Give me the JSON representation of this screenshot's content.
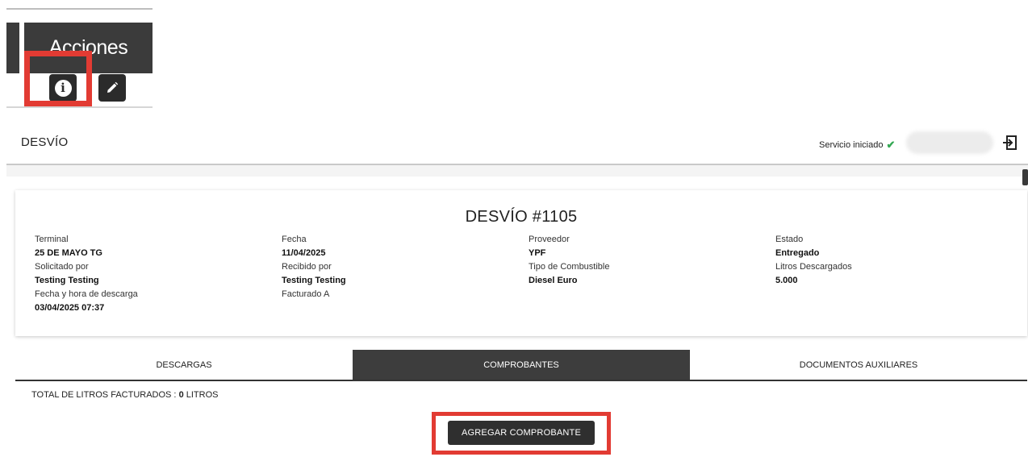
{
  "snippet": {
    "header_label": "Acciones"
  },
  "app": {
    "title": "DESVÍO",
    "status_text": "Servicio iniciado"
  },
  "detail": {
    "title": "DESVÍO #1105",
    "terminal_label": "Terminal",
    "terminal_value": "25 DE MAYO TG",
    "solicitado_label": "Solicitado por",
    "solicitado_value": "Testing Testing",
    "descarga_label": "Fecha y hora de descarga",
    "descarga_value": "03/04/2025 07:37",
    "fecha_label": "Fecha",
    "fecha_value": "11/04/2025",
    "recibido_label": "Recibido por",
    "recibido_value": "Testing Testing",
    "facturado_label": "Facturado A",
    "proveedor_label": "Proveedor",
    "proveedor_value": "YPF",
    "combustible_label": "Tipo de Combustible",
    "combustible_value": "Diesel Euro",
    "estado_label": "Estado",
    "estado_value": "Entregado",
    "litros_label": "Litros Descargados",
    "litros_value": "5.000"
  },
  "tabs": [
    {
      "label": "DESCARGAS",
      "active": false
    },
    {
      "label": "COMPROBANTES",
      "active": true
    },
    {
      "label": "DOCUMENTOS AUXILIARES",
      "active": false
    }
  ],
  "comprobantes": {
    "total_prefix": "TOTAL DE LITROS FACTURADOS :",
    "total_value": "0",
    "total_unit": "LITROS",
    "add_button_label": "AGREGAR COMPROBANTE"
  },
  "colors": {
    "highlight": "#e23b33",
    "dark": "#3d3d3d",
    "success": "#34a853"
  }
}
